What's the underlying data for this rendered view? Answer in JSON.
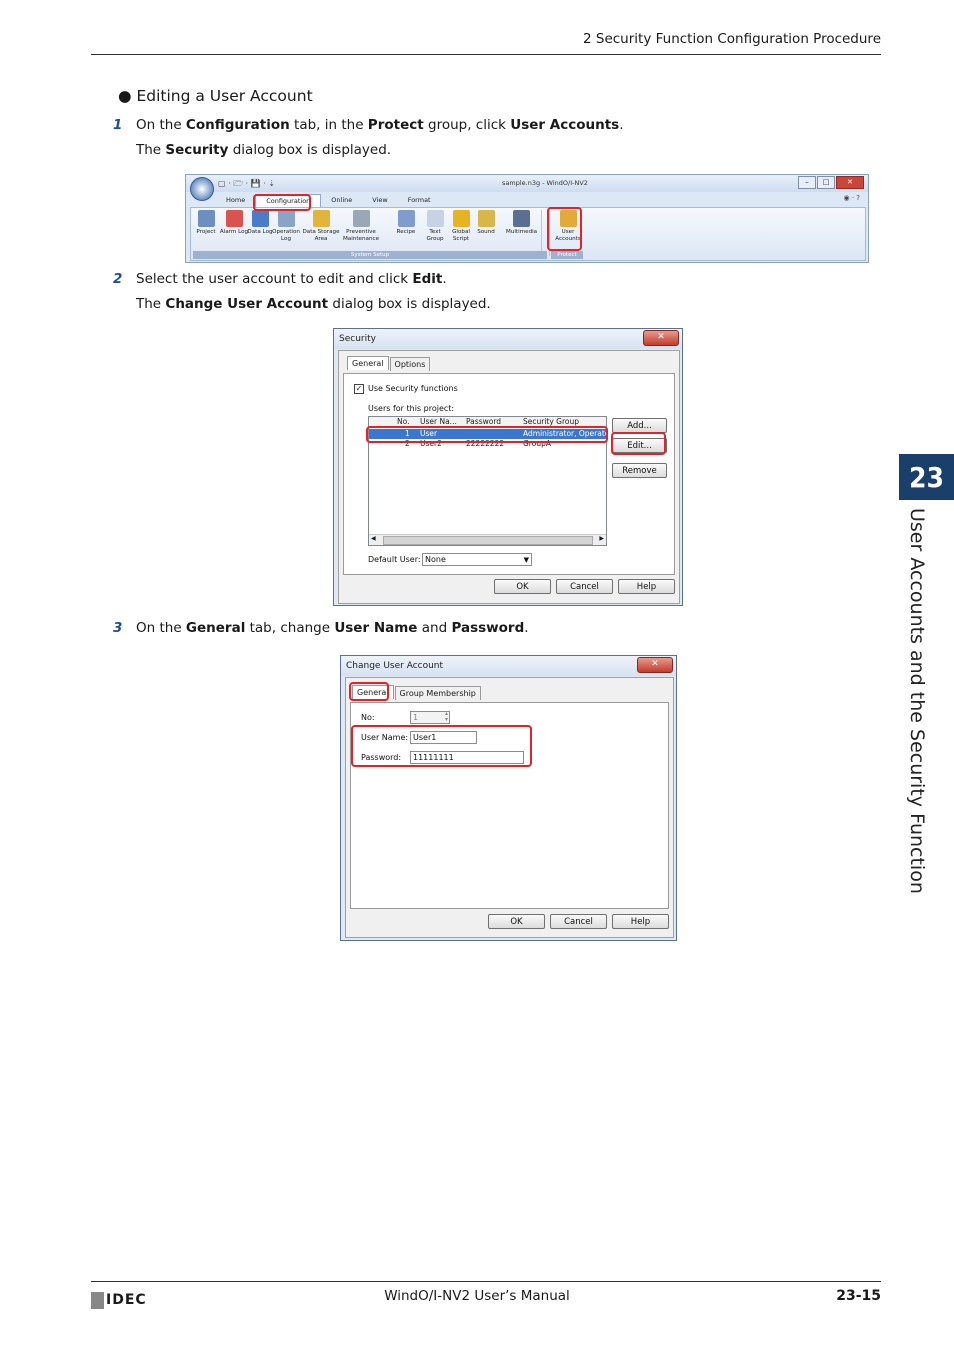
{
  "header": {
    "section_title": "2 Security Function Configuration Procedure"
  },
  "side_tab": {
    "chapter_number": "23",
    "chapter_title": "User Accounts and the Security Function"
  },
  "heading": {
    "bullet": "●",
    "text": "Editing a User Account"
  },
  "steps": [
    {
      "number": "1",
      "text_parts": [
        "On the ",
        "Configuration",
        " tab, in the ",
        "Protect",
        " group, click ",
        "User Accounts",
        "."
      ],
      "result_parts": [
        "The ",
        "Security",
        " dialog box is displayed."
      ]
    },
    {
      "number": "2",
      "text_parts": [
        "Select the user account to edit and click ",
        "Edit",
        "."
      ],
      "result_parts": [
        "The ",
        "Change User Account",
        " dialog box is displayed."
      ]
    },
    {
      "number": "3",
      "text_parts": [
        "On the ",
        "General",
        " tab, change ",
        "User Name",
        " and ",
        "Password",
        "."
      ]
    }
  ],
  "ribbon": {
    "window_title": "sample.n3g - WindO/I-NV2",
    "quick_access": "▢ · 🗁 · 💾 · ⇣",
    "tabs": [
      "Home",
      "Configuration",
      "Online",
      "View",
      "Format"
    ],
    "selected_tab": "Configuration",
    "buttons": [
      {
        "label": "Project",
        "icon": "project-icon",
        "color": "#6d8fc0"
      },
      {
        "label": "Alarm Log",
        "icon": "alarm-log-icon",
        "color": "#d9534f"
      },
      {
        "label": "Data Log",
        "icon": "data-log-icon",
        "color": "#4a7cc7"
      },
      {
        "label": "Operation Log",
        "icon": "operation-log-icon",
        "color": "#8aa4c8"
      },
      {
        "label": "Data Storage Area",
        "icon": "data-storage-icon",
        "color": "#e0b53a"
      },
      {
        "label": "Preventive Maintenance",
        "icon": "maintenance-icon",
        "color": "#9aa7b5"
      },
      {
        "label": "Recipe",
        "icon": "recipe-icon",
        "color": "#7f9ccc"
      },
      {
        "label": "Text Group",
        "icon": "text-group-icon",
        "color": "#c7d3e4"
      },
      {
        "label": "Global Script",
        "icon": "global-script-icon",
        "color": "#e6b422"
      },
      {
        "label": "Sound",
        "icon": "sound-icon",
        "color": "#d7b64a"
      },
      {
        "label": "Multimedia",
        "icon": "multimedia-icon",
        "color": "#5a6f92"
      },
      {
        "label": "User Accounts",
        "icon": "user-accounts-icon",
        "color": "#e2a93b"
      }
    ],
    "groups": [
      "System Setup",
      "Protect"
    ]
  },
  "security_dialog": {
    "title": "Security",
    "tabs": [
      "General",
      "Options"
    ],
    "checkbox_label": "Use Security functions",
    "checkbox_checked": true,
    "list_label": "Users for this project:",
    "columns": [
      "No.",
      "User Na...",
      "Password",
      "Security Group"
    ],
    "rows": [
      {
        "no": "1",
        "user": "User",
        "password": "",
        "group": "Administrator, Operator",
        "selected": true
      },
      {
        "no": "2",
        "user": "User2",
        "password": "22222222",
        "group": "GroupA",
        "selected": false
      }
    ],
    "buttons": [
      "Add...",
      "Edit...",
      "Remove"
    ],
    "default_user_label": "Default User:",
    "default_user_value": "None",
    "footer_buttons": [
      "OK",
      "Cancel",
      "Help"
    ]
  },
  "change_dialog": {
    "title": "Change User Account",
    "tabs": [
      "General",
      "Group Membership"
    ],
    "no_label": "No:",
    "no_value": "1",
    "user_name_label": "User Name:",
    "user_name_value": "User1",
    "password_label": "Password:",
    "password_value": "11111111",
    "footer_buttons": [
      "OK",
      "Cancel",
      "Help"
    ]
  },
  "footer": {
    "manual_title": "WindO/I-NV2 User’s Manual",
    "page_number": "23-15",
    "logo_text": "IDEC"
  }
}
